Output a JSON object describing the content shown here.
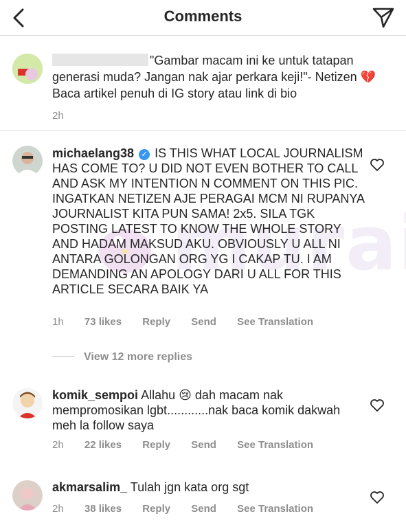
{
  "header": {
    "title": "Comments"
  },
  "caption": {
    "text": "\"Gambar macam ini ke untuk tatapan generasi muda? Jangan nak ajar perkara keji!\"- Netizen",
    "emoji": "💔",
    "text2": "Baca artikel penuh di IG story atau link di bio",
    "time": "2h"
  },
  "comments": [
    {
      "username": "michaelang38",
      "verified": true,
      "text": "IS THIS WHAT LOCAL JOURNALISM HAS COME TO? U DID NOT EVEN BOTHER TO CALL AND ASK MY INTENTION N COMMENT ON THIS PIC. INGATKAN NETIZEN AJE PERAGAI MCM NI RUPANYA JOURNALIST KITA PUN SAMA! 2x5. SILA TGK POSTING LATEST TO KNOW THE WHOLE STORY AND HADAM MAKSUD AKU. OBVIOUSLY U ALL NI ANTARA GOLONGAN ORG YG I CAKAP TU. I AM DEMANDING AN APOLOGY DARI U ALL FOR THIS ARTICLE SECARA BAIK YA",
      "time": "1h",
      "likes": "73 likes",
      "reply": "Reply",
      "send": "Send",
      "translate": "See Translation"
    },
    {
      "username": "komik_sempoi",
      "text_a": "Allahu",
      "emoji": "😢",
      "text_b": "dah macam nak mempromosikan lgbt............nak baca komik dakwah meh la follow saya",
      "time": "2h",
      "likes": "22 likes",
      "reply": "Reply",
      "send": "Send",
      "translate": "See Translation"
    },
    {
      "username": "akmarsalim_",
      "text": "Tulah jgn kata org sgt",
      "time": "2h",
      "likes": "38 likes",
      "reply": "Reply",
      "send": "Send",
      "translate": "See Translation"
    }
  ],
  "view_replies": "View 12 more replies",
  "watermark": "murai",
  "colors": {
    "text": "#262626",
    "muted": "#8e8e8e",
    "verified": "#3897f0",
    "divider": "#dbdbdb"
  },
  "icons": {
    "back": "chevron-left-icon",
    "send": "paper-plane-icon",
    "like": "heart-outline-icon"
  }
}
